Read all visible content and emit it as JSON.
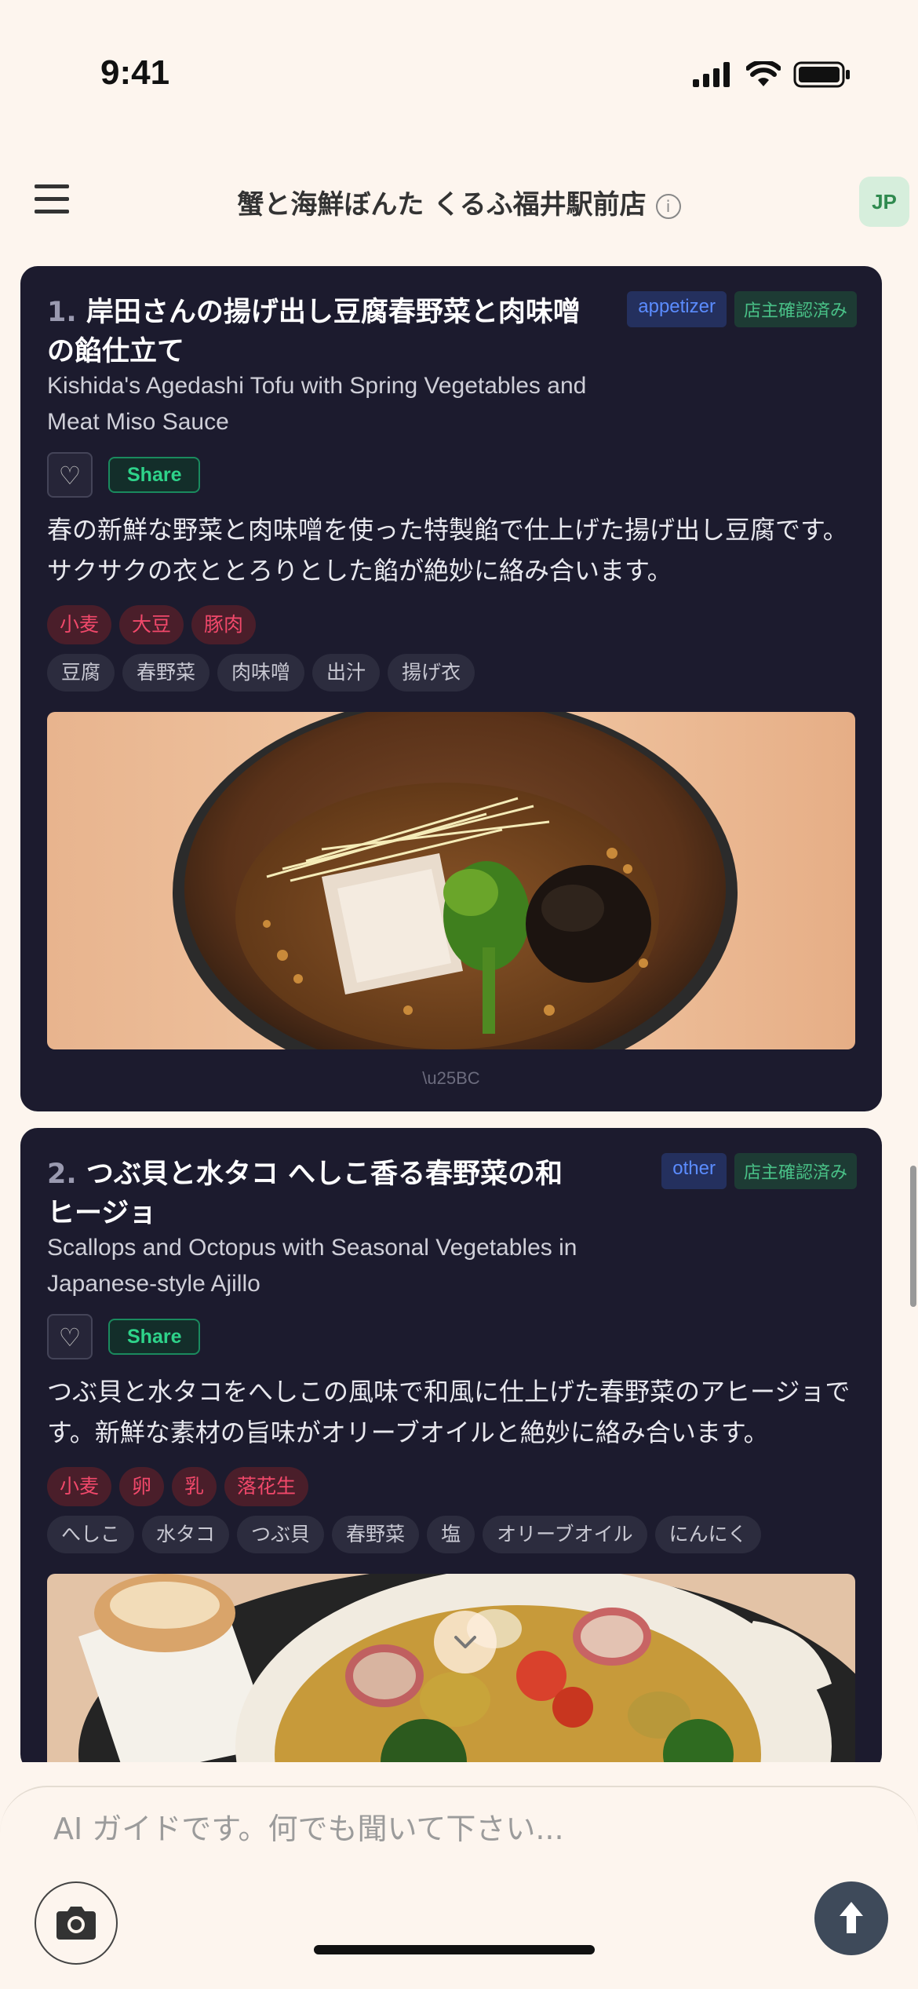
{
  "status": {
    "time": "9:41"
  },
  "header": {
    "title": "蟹と海鮮ぼんた くるふ福井駅前店",
    "lang": "JP"
  },
  "items": [
    {
      "num": "1.",
      "title": "岸田さんの揚げ出し豆腐春野菜と肉味噌の餡仕立て",
      "category": "appetizer",
      "verified": "店主確認済み",
      "en": "Kishida's Agedashi Tofu with Spring Vegetables and Meat Miso Sauce",
      "share": "Share",
      "desc": "春の新鮮な野菜と肉味噌を使った特製餡で仕上げた揚げ出し豆腐です。サクサクの衣ととろりとした餡が絶妙に絡み合います。",
      "allergens": [
        "小麦",
        "大豆",
        "豚肉"
      ],
      "ingredients": [
        "豆腐",
        "春野菜",
        "肉味噌",
        "出汁",
        "揚げ衣"
      ],
      "caption": "\\u25BC"
    },
    {
      "num": "2.",
      "title": "つぶ貝と水タコ へしこ香る春野菜の和ヒージョ",
      "category": "other",
      "verified": "店主確認済み",
      "en": "Scallops and Octopus with Seasonal Vegetables in Japanese-style Ajillo",
      "share": "Share",
      "desc": "つぶ貝と水タコをへしこの風味で和風に仕上げた春野菜のアヒージョです。新鮮な素材の旨味がオリーブオイルと絶妙に絡み合います。",
      "allergens": [
        "小麦",
        "卵",
        "乳",
        "落花生"
      ],
      "ingredients": [
        "へしこ",
        "水タコ",
        "つぶ貝",
        "春野菜",
        "塩",
        "オリーブオイル",
        "にんにく"
      ]
    }
  ],
  "chat": {
    "placeholder": "AI ガイドです。何でも聞いて下さい..."
  },
  "icons": {
    "menu": "hamburger-icon",
    "info": "info-icon",
    "heart": "heart-icon",
    "camera": "camera-icon",
    "send": "arrow-up-icon",
    "scroll": "chevron-down-icon"
  },
  "colors": {
    "background": "#fdf5ee",
    "card": "#1c1b2e",
    "allergen": "#f0486a",
    "share": "#2ed38a",
    "category": "#5b8cff"
  }
}
